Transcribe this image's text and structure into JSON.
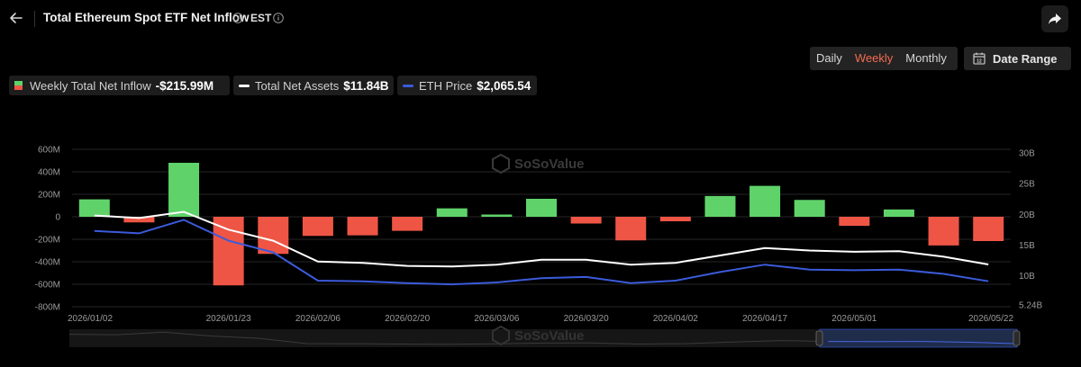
{
  "header": {
    "title": "Total Ethereum Spot ETF Net Inflow",
    "timezone": "EST",
    "back_icon": "arrow-left-icon",
    "info_icon": "info-circle-icon",
    "share_icon": "share-arrow-icon"
  },
  "controls": {
    "periods": [
      "Daily",
      "Weekly",
      "Monthly"
    ],
    "active_period": "Weekly",
    "date_range_label": "Date Range",
    "date_range_icon": "calendar-icon",
    "active_color": "#f26b52"
  },
  "legend": [
    {
      "label": "Weekly Total Net Inflow",
      "value": "-$215.99M",
      "swatch": "bar",
      "color": "#5fd36a"
    },
    {
      "label": "Total Net Assets",
      "value": "$11.84B",
      "swatch": "line",
      "color": "#ffffff"
    },
    {
      "label": "ETH Price",
      "value": "$2,065.54",
      "swatch": "line",
      "color": "#3b5bdb"
    }
  ],
  "watermark": "SoSoValue",
  "chart_data": {
    "type": "bar",
    "y_left": {
      "ticks": [
        "600M",
        "400M",
        "200M",
        "0",
        "-200M",
        "-400M",
        "-600M",
        "-800M"
      ],
      "ylim": [
        -800,
        600
      ],
      "unit": "M"
    },
    "y_right": {
      "ticks": [
        "30B",
        "25B",
        "20B",
        "15B",
        "10B",
        "5.24B"
      ],
      "tick_values": [
        30,
        25,
        20,
        15,
        10,
        5.24
      ],
      "ylim": [
        5.24,
        30
      ]
    },
    "x_tick_labels": [
      "2026/01/02",
      "2026/01/23",
      "2026/02/06",
      "2026/02/20",
      "2026/03/06",
      "2026/03/20",
      "2026/04/02",
      "2026/04/17",
      "2026/05/01",
      "2026/05/22"
    ],
    "colors": {
      "positive": "#5fd36a",
      "negative": "#ee5545",
      "assets": "#ffffff",
      "price": "#3b5bdb"
    },
    "series": [
      {
        "name": "Weekly Total Net Inflow",
        "type": "bar",
        "values": [
          155,
          -50,
          480,
          -610,
          -330,
          -170,
          -165,
          -125,
          75,
          20,
          160,
          -60,
          -210,
          -40,
          185,
          275,
          150,
          -80,
          65,
          -255,
          -216
        ]
      },
      {
        "name": "Total Net Assets",
        "type": "line",
        "values": [
          19.8,
          19.4,
          20.4,
          17.5,
          15.7,
          12.3,
          12.1,
          11.6,
          11.5,
          11.8,
          12.6,
          12.6,
          11.8,
          12.1,
          13.3,
          14.5,
          14.1,
          13.9,
          14.0,
          13.1,
          11.84
        ]
      },
      {
        "name": "ETH Price",
        "type": "line",
        "values": [
          17.3,
          16.9,
          19.1,
          15.7,
          13.8,
          9.2,
          9.1,
          8.8,
          8.6,
          8.9,
          9.6,
          9.8,
          8.8,
          9.2,
          10.6,
          11.8,
          11.0,
          10.9,
          11.0,
          10.3,
          9.1
        ]
      }
    ]
  }
}
